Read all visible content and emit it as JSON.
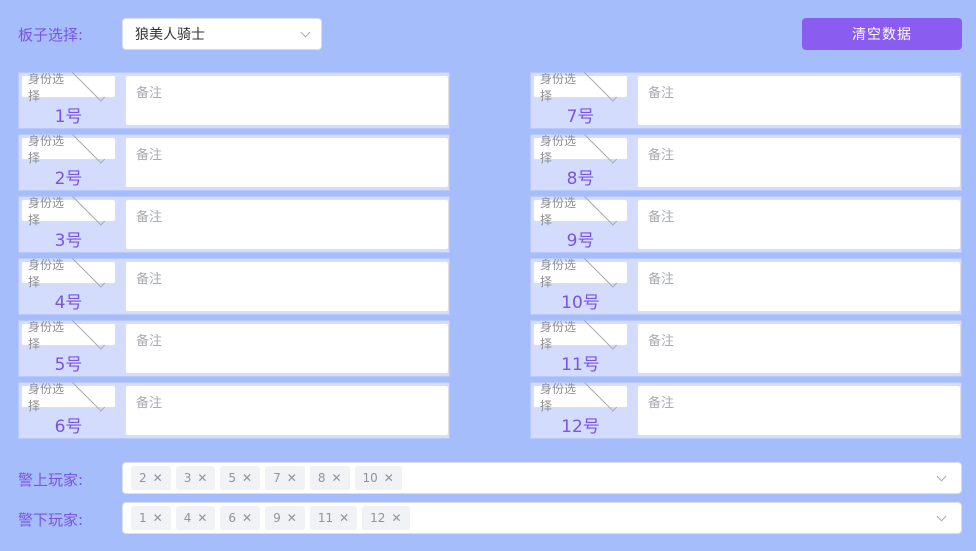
{
  "header": {
    "board_label": "板子选择:",
    "board_value": "狼美人骑士",
    "clear_label": "清空数据"
  },
  "seats": {
    "left": [
      {
        "id_placeholder": "身份选择",
        "number": "1号",
        "note_placeholder": "备注"
      },
      {
        "id_placeholder": "身份选择",
        "number": "2号",
        "note_placeholder": "备注"
      },
      {
        "id_placeholder": "身份选择",
        "number": "3号",
        "note_placeholder": "备注"
      },
      {
        "id_placeholder": "身份选择",
        "number": "4号",
        "note_placeholder": "备注"
      },
      {
        "id_placeholder": "身份选择",
        "number": "5号",
        "note_placeholder": "备注"
      },
      {
        "id_placeholder": "身份选择",
        "number": "6号",
        "note_placeholder": "备注"
      }
    ],
    "right": [
      {
        "id_placeholder": "身份选择",
        "number": "7号",
        "note_placeholder": "备注"
      },
      {
        "id_placeholder": "身份选择",
        "number": "8号",
        "note_placeholder": "备注"
      },
      {
        "id_placeholder": "身份选择",
        "number": "9号",
        "note_placeholder": "备注"
      },
      {
        "id_placeholder": "身份选择",
        "number": "10号",
        "note_placeholder": "备注"
      },
      {
        "id_placeholder": "身份选择",
        "number": "11号",
        "note_placeholder": "备注"
      },
      {
        "id_placeholder": "身份选择",
        "number": "12号",
        "note_placeholder": "备注"
      }
    ]
  },
  "sheriff_up": {
    "label": "警上玩家:",
    "tags": [
      "2",
      "3",
      "5",
      "7",
      "8",
      "10"
    ]
  },
  "sheriff_down": {
    "label": "警下玩家:",
    "tags": [
      "1",
      "4",
      "6",
      "9",
      "11",
      "12"
    ]
  },
  "colors": {
    "background": "#a6bdfb",
    "accent": "#8a5cf0",
    "label_text": "#7a55e0"
  },
  "icons": {
    "dropdown": "chevron-down-icon",
    "tag_remove": "close-icon",
    "resize": "resize-grip-icon"
  }
}
